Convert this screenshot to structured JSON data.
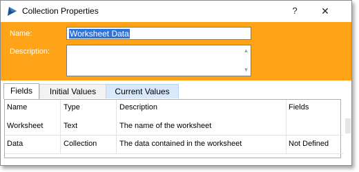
{
  "window": {
    "title": "Collection Properties"
  },
  "titlebar": {
    "help_glyph": "?",
    "close_glyph": "✕"
  },
  "header": {
    "name_label": "Name:",
    "name_value": "Worksheet Data",
    "description_label": "Description:",
    "description_value": "",
    "background_color": "#ffa319"
  },
  "tabs": [
    {
      "label": "Fields",
      "selected": true
    },
    {
      "label": "Initial Values",
      "selected": false
    },
    {
      "label": "Current Values",
      "selected": false
    }
  ],
  "grid": {
    "columns": [
      "Name",
      "Type",
      "Description",
      "Fields"
    ],
    "rows": [
      [
        "Worksheet",
        "Text",
        "The name of the worksheet",
        ""
      ],
      [
        "Data",
        "Collection",
        "The data contained in the worksheet",
        "Not Defined"
      ]
    ]
  }
}
